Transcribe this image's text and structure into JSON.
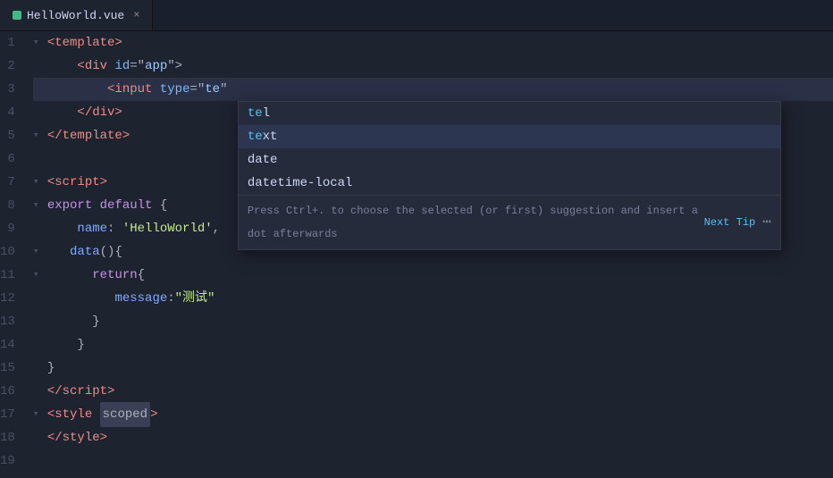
{
  "tab": {
    "filename": "HelloWorld.vue",
    "close_label": "×"
  },
  "lines": [
    {
      "num": 1,
      "fold": true,
      "content": "template_open"
    },
    {
      "num": 2,
      "fold": false,
      "content": "div_open"
    },
    {
      "num": 3,
      "fold": false,
      "content": "input_line",
      "active": true
    },
    {
      "num": 4,
      "fold": false,
      "content": "div_close"
    },
    {
      "num": 5,
      "fold": true,
      "content": "template_close"
    },
    {
      "num": 6,
      "fold": false,
      "content": "blank"
    },
    {
      "num": 7,
      "fold": true,
      "content": "script_open"
    },
    {
      "num": 8,
      "fold": true,
      "content": "export_default"
    },
    {
      "num": 9,
      "fold": false,
      "content": "name_prop"
    },
    {
      "num": 10,
      "fold": true,
      "content": "data_fn"
    },
    {
      "num": 11,
      "fold": true,
      "content": "return_open"
    },
    {
      "num": 12,
      "fold": false,
      "content": "message_prop"
    },
    {
      "num": 13,
      "fold": false,
      "content": "brace_close1"
    },
    {
      "num": 14,
      "fold": false,
      "content": "brace_close2"
    },
    {
      "num": 15,
      "fold": false,
      "content": "brace_close3"
    },
    {
      "num": 16,
      "fold": false,
      "content": "script_close"
    },
    {
      "num": 17,
      "fold": true,
      "content": "style_open"
    },
    {
      "num": 18,
      "fold": false,
      "content": "style_close"
    },
    {
      "num": 19,
      "fold": false,
      "content": "blank"
    }
  ],
  "autocomplete": {
    "items": [
      {
        "id": "tel",
        "match": "te",
        "rest": "l",
        "selected": false
      },
      {
        "id": "text",
        "match": "te",
        "rest": "xt",
        "selected": true
      },
      {
        "id": "date",
        "match": "",
        "rest": "date",
        "selected": false
      },
      {
        "id": "datetime-local",
        "match": "",
        "rest": "datetime-local",
        "selected": false
      }
    ],
    "hint": "Press Ctrl+. to choose the selected (or first) suggestion and insert a dot afterwards",
    "next_tip_label": "Next Tip",
    "more_label": "⋯"
  }
}
